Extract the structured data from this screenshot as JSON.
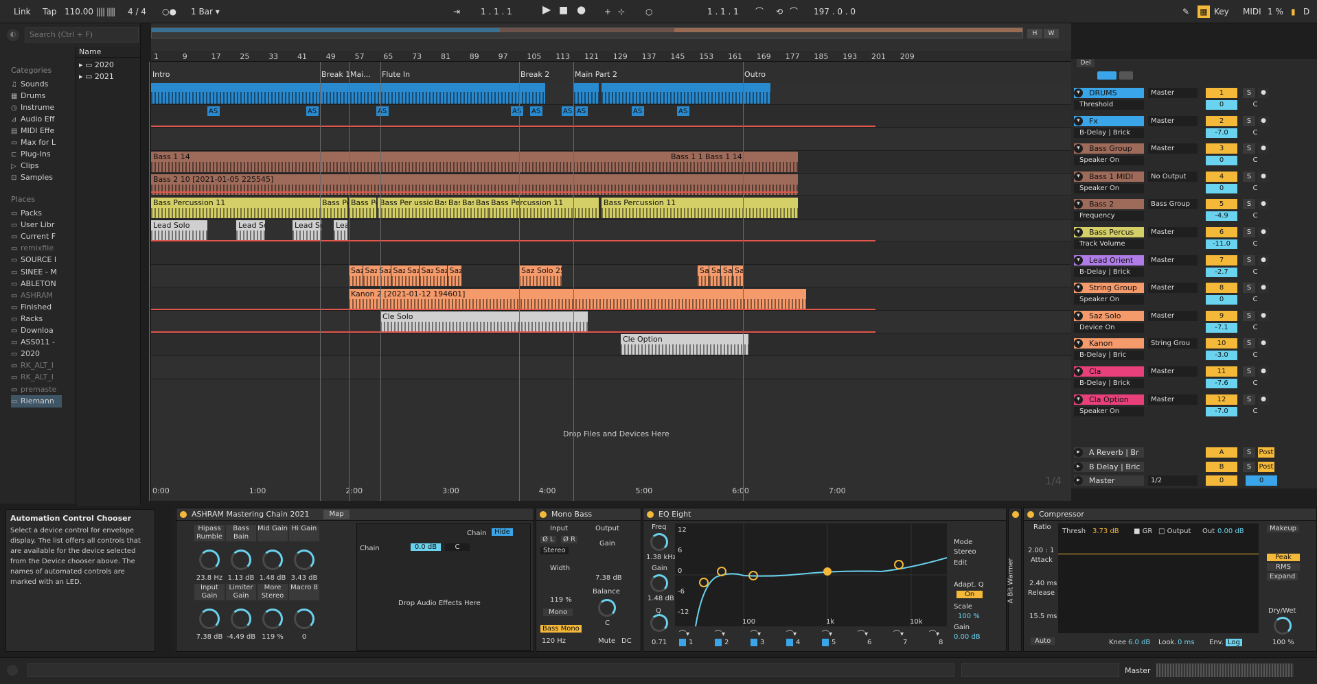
{
  "transport": {
    "link": "Link",
    "tap": "Tap",
    "tempo": "110.00",
    "signature": "4 / 4",
    "quant": "1 Bar",
    "pos": "1 .  1 .  1",
    "loop_pos": "1 .  1 .  1",
    "loop_len": "197 .  0 .  0",
    "key": "Key",
    "midi": "MIDI",
    "cpu": "1 %",
    "d": "D"
  },
  "browser": {
    "search_placeholder": "Search (Ctrl + F)",
    "categories_label": "Categories",
    "categories": [
      "Sounds",
      "Drums",
      "Instrume",
      "Audio Eff",
      "MIDI Effe",
      "Max for L",
      "Plug-Ins",
      "Clips",
      "Samples"
    ],
    "places_label": "Places",
    "places": [
      "Packs",
      "User Libr",
      "Current F",
      "remixfile",
      "SOURCE I",
      "SINEE - M",
      "ABLETON",
      "ASHRAM",
      "Finished",
      "Racks",
      "Downloa",
      "ASS011 -",
      "2020",
      "RK_ALT_I",
      "RK_ALT_I",
      "premaste",
      "Riemann"
    ],
    "name_header": "Name",
    "folders": [
      "2020",
      "2021"
    ]
  },
  "info": {
    "title": "Automation Control Chooser",
    "desc": "Select a device control for envelope display. The list offers all controls that are available for the device selected from the Device chooser above. The names of automated controls are marked with an LED."
  },
  "ruler": {
    "bars": [
      "1",
      "9",
      "17",
      "25",
      "33",
      "41",
      "49",
      "57",
      "65",
      "73",
      "81",
      "89",
      "97",
      "105",
      "113",
      "121",
      "129",
      "137",
      "145",
      "153",
      "161",
      "169",
      "177",
      "185",
      "193",
      "201",
      "209"
    ]
  },
  "locators": [
    "Intro",
    "Break 1",
    "Mai...",
    "Flute In",
    "Break 2",
    "Main Part 2",
    "Outro"
  ],
  "clips": {
    "bass1": "Bass 1 14",
    "bass1b": "Bass 1 14",
    "bass1c": "Bass 1 14",
    "bass2": "Bass 2 10 [2021-01-05 225545]",
    "perc1": "Bass Percussion 11",
    "perc2": "Bass Perc",
    "perc3": "Bass Per",
    "perc4": "Bass Perc",
    "perc5": "ussion 1",
    "perc6": "Bass",
    "perc7": "Bass",
    "perc8": "Bas",
    "perc9": "Bass",
    "perc10": "Bass Percussion 11",
    "perc11": "Bass Percussion 11",
    "lead1": "Lead Solo",
    "lead2": "Lead Solo",
    "lead3": "Lead Solo",
    "lead4": "Lead",
    "saz": "Saz",
    "saz25": "Saz Solo 25",
    "kanon": "Kanon 2 [2021-01-12 194601]",
    "cle": "Cle Solo",
    "cleopt": "Cle Option",
    "as": "AS"
  },
  "drop_files": "Drop Files and Devices Here",
  "timeline": [
    "0:00",
    "1:00",
    "2:00",
    "3:00",
    "4:00",
    "5:00",
    "6:00",
    "7:00"
  ],
  "zoom": "1/4",
  "tracks": [
    {
      "name": "DRUMS",
      "color": "#3aa5e8",
      "sub": "Threshold",
      "out": "Master",
      "num": "1",
      "vol": "0"
    },
    {
      "name": "Fx",
      "color": "#3aa5e8",
      "sub": "B-Delay | Brick",
      "out": "Master",
      "num": "2",
      "vol": "-7.0"
    },
    {
      "name": "Bass Group",
      "color": "#9e6a5a",
      "sub": "Speaker On",
      "out": "Master",
      "num": "3",
      "vol": "0"
    },
    {
      "name": "Bass 1 MIDI",
      "color": "#9e6a5a",
      "sub": "Speaker On",
      "out": "No Output",
      "num": "4",
      "vol": "0"
    },
    {
      "name": "Bass 2",
      "color": "#9e6a5a",
      "sub": "Frequency",
      "out": "Bass Group",
      "num": "5",
      "vol": "-4.9"
    },
    {
      "name": "Bass Percus",
      "color": "#d4cf66",
      "sub": "Track Volume",
      "out": "Master",
      "num": "6",
      "vol": "-11.0"
    },
    {
      "name": "Lead Orient",
      "color": "#b07ce8",
      "sub": "B-Delay | Brick",
      "out": "Master",
      "num": "7",
      "vol": "-2.7"
    },
    {
      "name": "String Group",
      "color": "#f59a6a",
      "sub": "Speaker On",
      "out": "Master",
      "num": "8",
      "vol": "0"
    },
    {
      "name": "Saz Solo",
      "color": "#f59a6a",
      "sub": "Device On",
      "out": "Master",
      "num": "9",
      "vol": "-7.1"
    },
    {
      "name": "Kanon",
      "color": "#f59a6a",
      "sub": "B-Delay | Bric",
      "out": "String Grou",
      "num": "10",
      "vol": "-3.0"
    },
    {
      "name": "Cla",
      "color": "#e8407a",
      "sub": "B-Delay | Brick",
      "out": "Master",
      "num": "11",
      "vol": "-7.6"
    },
    {
      "name": "Cla Option",
      "color": "#e8407a",
      "sub": "Speaker On",
      "out": "Master",
      "num": "12",
      "vol": "-7.0"
    }
  ],
  "returns": [
    {
      "name": "A Reverb | Br",
      "num": "A",
      "post": "Post"
    },
    {
      "name": "B Delay | Bric",
      "num": "B",
      "post": "Post"
    },
    {
      "name": "Master",
      "out": "1/2",
      "num": "0",
      "vol": "0"
    }
  ],
  "mixer_labels": {
    "del": "Del",
    "solo": "S",
    "center": "C"
  },
  "devices": {
    "chain": {
      "title": "ASHRAM Mastering Chain 2021",
      "map": "Map",
      "macros": [
        {
          "l": "Hipass Rumble",
          "v": "23.8 Hz"
        },
        {
          "l": "Bass Bain",
          "v": "1.13 dB"
        },
        {
          "l": "Mid Gain",
          "v": "1.48 dB"
        },
        {
          "l": "Hi Gain",
          "v": "3.43 dB"
        },
        {
          "l": "Input Gain",
          "v": "7.38 dB"
        },
        {
          "l": "Limiter Gain",
          "v": "-4.49 dB"
        },
        {
          "l": "More Stereo",
          "v": "119 %"
        },
        {
          "l": "Macro 8",
          "v": "0"
        }
      ],
      "chain_label": "Chain",
      "hide": "Hide",
      "chain_name": "Chain",
      "chain_vol": "0.0 dB",
      "chain_pan": "C",
      "drop": "Drop Audio Effects Here"
    },
    "mono": {
      "title": "Mono Bass",
      "input": "Input",
      "output": "Output",
      "ol": "Ø L",
      "or": "Ø R",
      "stereo": "Stereo",
      "width": "Width",
      "width_v": "119 %",
      "mono": "Mono",
      "gain": "Gain",
      "gain_v": "7.38 dB",
      "balance": "Balance",
      "balance_v": "C",
      "bassmono": "Bass Mono",
      "freq": "120 Hz",
      "mute": "Mute",
      "dc": "DC"
    },
    "eq": {
      "title": "EQ Eight",
      "freq": "Freq",
      "freq_v": "1.38 kHz",
      "gain": "Gain",
      "gain_v": "1.48 dB",
      "q": "Q",
      "q_v": "0.71",
      "scale_y": [
        "12",
        "6",
        "0",
        "-6",
        "-12"
      ],
      "scale_x": [
        "100",
        "1k",
        "10k"
      ],
      "bands": [
        "1",
        "2",
        "3",
        "4",
        "5",
        "6",
        "7",
        "8"
      ],
      "mode": "Mode",
      "stereo": "Stereo",
      "edit": "Edit",
      "adapt": "Adapt. Q",
      "on": "On",
      "scale": "Scale",
      "scale_v": "100 %",
      "gain2": "Gain",
      "gain2_v": "0.00 dB"
    },
    "warmer": {
      "title": "A Bit Warmer"
    },
    "comp": {
      "title": "Compressor",
      "ratio": "Ratio",
      "ratio_v": "2.00 : 1",
      "attack": "Attack",
      "attack_v": "2.40 ms",
      "release": "Release",
      "release_v": "15.5 ms",
      "auto": "Auto",
      "thresh": "Thresh",
      "thresh_v": "3.73 dB",
      "gr": "GR",
      "output": "Output",
      "out": "Out",
      "out_v": "0.00 dB",
      "makeup": "Makeup",
      "peak": "Peak",
      "rms": "RMS",
      "expand": "Expand",
      "drywet": "Dry/Wet",
      "drywet_v": "100 %",
      "knee": "Knee",
      "knee_v": "6.0 dB",
      "look": "Look.",
      "look_v": "0 ms",
      "env": "Env.",
      "log": "Log"
    }
  },
  "status": {
    "master": "Master"
  }
}
